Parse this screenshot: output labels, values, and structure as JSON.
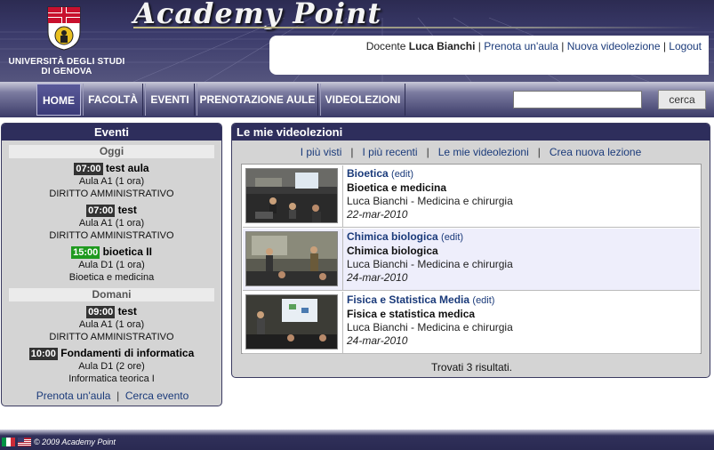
{
  "header": {
    "brand": "Academy Point",
    "university": "UNIVERSITÀ DEGLI STUDI DI GENOVA",
    "user_prefix": "Docente",
    "user_name": "Luca Bianchi",
    "links": [
      "Prenota un'aula",
      "Nuova videolezione",
      "Logout"
    ]
  },
  "nav": {
    "tabs": [
      "HOME",
      "FACOLTÀ",
      "EVENTI",
      "PRENOTAZIONE AULE",
      "VIDEOLEZIONI"
    ],
    "search_button": "cerca",
    "search_value": ""
  },
  "events": {
    "title": "Eventi",
    "days": [
      {
        "label": "Oggi",
        "items": [
          {
            "time": "07:00",
            "title": "test aula",
            "room": "Aula A1  (1 ora)",
            "course": "DIRITTO AMMINISTRATIVO"
          },
          {
            "time": "07:00",
            "title": "test",
            "room": "Aula A1  (1 ora)",
            "course": "DIRITTO AMMINISTRATIVO"
          },
          {
            "time": "15:00",
            "title": "bioetica II",
            "room": "Aula D1  (1 ora)",
            "course": "Bioetica e medicina"
          }
        ]
      },
      {
        "label": "Domani",
        "items": [
          {
            "time": "09:00",
            "title": "test",
            "room": "Aula A1  (1 ora)",
            "course": "DIRITTO AMMINISTRATIVO"
          },
          {
            "time": "10:00",
            "title": "Fondamenti di informatica",
            "room": "Aula D1  (2 ore)",
            "course": "Informatica teorica I"
          }
        ]
      }
    ],
    "link_book": "Prenota un'aula",
    "link_search": "Cerca evento"
  },
  "lessons": {
    "title": "Le mie videolezioni",
    "filters": [
      "I più visti",
      "I più recenti",
      "Le mie videolezioni",
      "Crea nuova lezione"
    ],
    "edit_label": "(edit)",
    "rows": [
      {
        "title": "Bioetica",
        "subject": "Bioetica e medicina",
        "author": "Luca Bianchi - Medicina e chirurgia",
        "date": "22-mar-2010"
      },
      {
        "title": "Chimica biologica",
        "subject": "Chimica biologica",
        "author": "Luca Bianchi - Medicina e chirurgia",
        "date": "24-mar-2010"
      },
      {
        "title": "Fisica e Statistica Media",
        "subject": "Fisica e statistica medica",
        "author": "Luca Bianchi - Medicina e chirurgia",
        "date": "24-mar-2010"
      }
    ],
    "results": "Trovati 3 risultati."
  },
  "footer": {
    "copyright": "© 2009 Academy Point"
  },
  "colors": {
    "header_bg": "#2c2b52",
    "panel_title_bg": "#2e2e5c",
    "link": "#1a3a7a",
    "time_badge": "#333333",
    "time_badge_highlight": "#1f9a1f"
  }
}
